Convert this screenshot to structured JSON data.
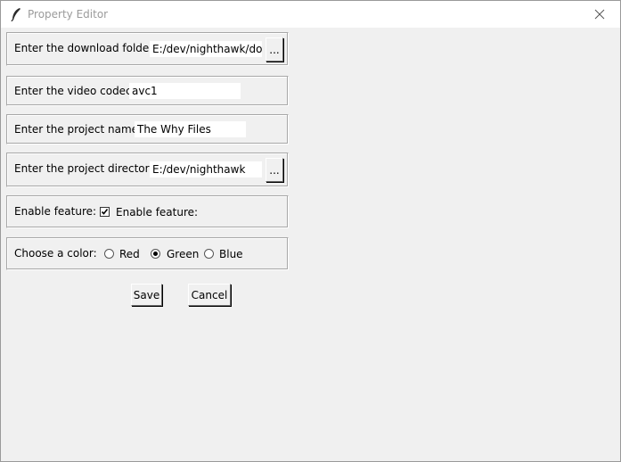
{
  "window": {
    "title": "Property Editor"
  },
  "download_folder": {
    "label": "Enter the download folder:",
    "value": "E:/dev/nighthawk/dow",
    "browse_label": "..."
  },
  "video_codec": {
    "label": "Enter the video codec:",
    "value": "avc1"
  },
  "project_name": {
    "label": "Enter the project name:",
    "value": "The Why Files"
  },
  "project_directory": {
    "label": "Enter the project directory:",
    "value": "E:/dev/nighthawk",
    "browse_label": "..."
  },
  "feature": {
    "label": "Enable feature:",
    "checkbox_label": "Enable feature:",
    "checked": true
  },
  "color": {
    "label": "Choose a color:",
    "options": [
      {
        "label": "Red",
        "selected": false
      },
      {
        "label": "Green",
        "selected": true
      },
      {
        "label": "Blue",
        "selected": false
      }
    ]
  },
  "actions": {
    "save_label": "Save",
    "cancel_label": "Cancel"
  }
}
